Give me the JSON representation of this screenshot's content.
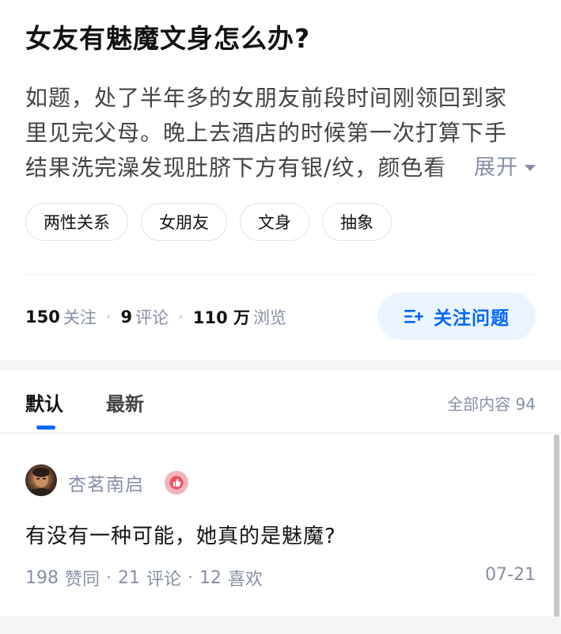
{
  "question": {
    "title": "女友有魅魔文身怎么办?",
    "body_lines": [
      "如题，处了半年多的女朋友前段时间刚领回到家",
      "里见完父母。晚上去酒店的时候第一次打算下手",
      "结果洗完澡发现肚脐下方有银/纹，颜色看"
    ],
    "expand_label": "展开",
    "tags": [
      "两性关系",
      "女朋友",
      "文身",
      "抽象"
    ]
  },
  "stats": {
    "followers_count": "150",
    "followers_label": "关注",
    "comments_count": "9",
    "comments_label": "评论",
    "views_count": "110 万",
    "views_label": "浏览"
  },
  "follow_button": {
    "label": "关注问题",
    "icon": "add-list-icon",
    "color": "#0066ff",
    "background": "#ebf5ff"
  },
  "tabs": {
    "default_label": "默认",
    "latest_label": "最新",
    "all_content_label": "全部内容 94",
    "active": "默认",
    "accent": "#0066ff"
  },
  "answers": [
    {
      "author": "杏茗南启",
      "badge_icon": "thumb-up-badge-icon",
      "text": "有没有一种可能，她真的是魅魔?",
      "likes_count": "198",
      "likes_label": "赞同",
      "comments_count": "21",
      "comments_label": "评论",
      "favorites_count": "12",
      "favorites_label": "喜欢",
      "date": "07-21"
    }
  ]
}
